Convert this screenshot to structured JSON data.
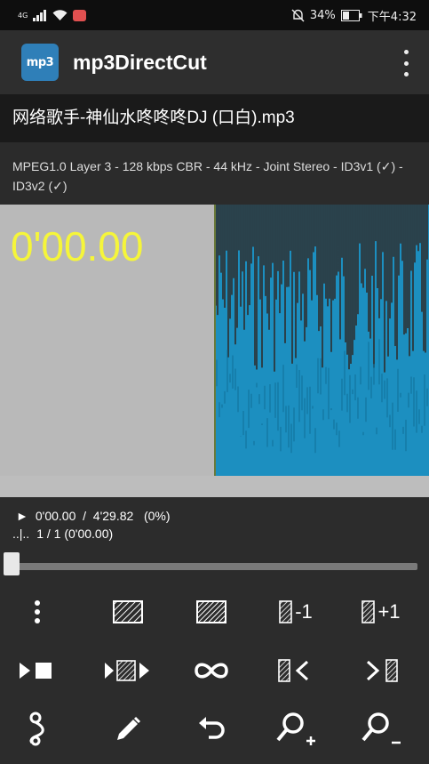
{
  "status_bar": {
    "signal_label": "4G",
    "battery": "34%",
    "time": "下午4:32"
  },
  "app": {
    "logo_text": "mp3",
    "title": "mp3DirectCut"
  },
  "file": {
    "name": "网络歌手-神仙水咚咚咚DJ (口白).mp3",
    "info": "MPEG1.0 Layer 3 - 128 kbps CBR - 44 kHz - Joint Stereo - ID3v1 (✓) - ID3v2 (✓)"
  },
  "player": {
    "time_display": "0'00.00",
    "position_marker": "►",
    "position_text": "0'00.00  /  4'29.82   (0%)",
    "selection_marker": "..|..",
    "selection_text": "1 / 1 (0'00.00)",
    "seek_progress": 0
  },
  "toolbar": {
    "minus_one_label": "-1",
    "plus_one_label": "+1"
  },
  "colors": {
    "time_display": "#f5f53a",
    "waveform": "#1c8fc0",
    "selection": "#b9b9b9",
    "app_bar": "#2e2e2e"
  },
  "icons": [
    "signal-icon",
    "wifi-icon",
    "notification-badge-icon",
    "mute-icon",
    "battery-icon",
    "more-vert-icon",
    "dots-vertical-icon",
    "hatch-select-icon",
    "hatch-fill-icon",
    "marker-minus-icon",
    "marker-plus-icon",
    "play-stop-icon",
    "play-section-icon",
    "loop-icon",
    "jump-start-icon",
    "jump-end-icon",
    "split-icon",
    "edit-icon",
    "undo-icon",
    "zoom-in-icon",
    "zoom-out-icon"
  ]
}
